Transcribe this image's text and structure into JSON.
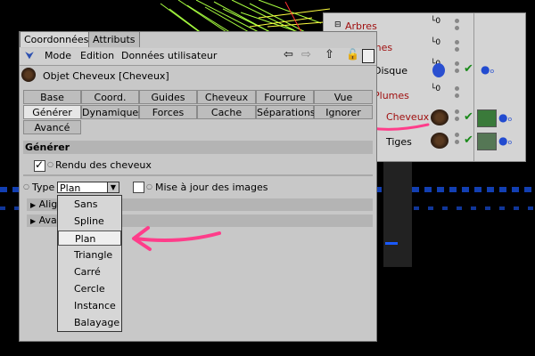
{
  "tabs": [
    "Coordonnées",
    "Attributs"
  ],
  "menu": [
    "Mode",
    "Edition",
    "Données utilisateur"
  ],
  "object_title": "Objet Cheveux [Cheveux]",
  "attr_tabs_row1": [
    "Base",
    "Coord.",
    "Guides",
    "Cheveux",
    "Fourrure",
    "Vue"
  ],
  "attr_tabs_row2": [
    "Générer",
    "Dynamiques",
    "Forces",
    "Cache",
    "Séparations",
    "Ignorer"
  ],
  "attr_tabs_row3": [
    "Avancé"
  ],
  "section_title": "Générer",
  "render_label": "Rendu des cheveux",
  "type_label": "Type",
  "type_value": "Plan",
  "update_label": "Mise à jour des images",
  "collapsed_rows": [
    "Alig",
    "Ava"
  ],
  "dropdown_options": [
    "Sans",
    "Spline",
    "Plan",
    "Triangle",
    "Carré",
    "Cercle",
    "Instance",
    "Balayage"
  ],
  "selected_option": "Plan",
  "objects": [
    {
      "name": "Arbres",
      "color": "#a01010"
    },
    {
      "name": "Palmes",
      "color": "#a01010"
    },
    {
      "name": "Disque",
      "color": "#000000"
    },
    {
      "name": "Plumes",
      "color": "#a01010"
    },
    {
      "name": "Cheveux",
      "color": "#a01010"
    },
    {
      "name": "Tiges",
      "color": "#000000"
    }
  ],
  "annotation_color": "#ff3d8a"
}
